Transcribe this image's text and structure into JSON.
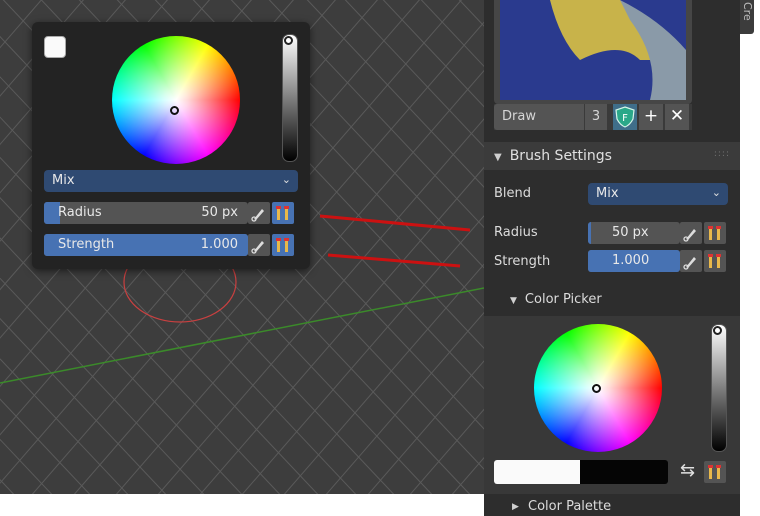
{
  "brush_panel": {
    "brush_name": "Draw",
    "brush_users": "3",
    "section_title": "Brush Settings",
    "blend_label": "Blend",
    "blend_value": "Mix",
    "radius_label": "Radius",
    "radius_value": "50 px",
    "radius_fraction": 0.03,
    "strength_label": "Strength",
    "strength_value": "1.000",
    "strength_fraction": 1.0,
    "color_picker_title": "Color Picker",
    "color_palette_title": "Color Palette",
    "side_tab_label": "Cre"
  },
  "popup": {
    "blend_value": "Mix",
    "radius_label": "Radius",
    "radius_value": "50 px",
    "radius_fraction": 0.08,
    "strength_label": "Strength",
    "strength_value": "1.000",
    "strength_fraction": 1.0
  },
  "colors": {
    "accent": "#4772b3",
    "dropdown": "#2f4a72",
    "panel_bg": "#2d2d2d",
    "viewport_bg": "#3d3d3d",
    "annotation_red": "#cc1111",
    "axis_green": "#3b8a2a"
  },
  "icons": [
    "fake-user-shield-icon",
    "new-brush-plus-icon",
    "unlink-x-icon",
    "pen-pressure-icon",
    "palette-swap-icon",
    "swap-colors-icon",
    "dropdown-chevron-icon"
  ]
}
